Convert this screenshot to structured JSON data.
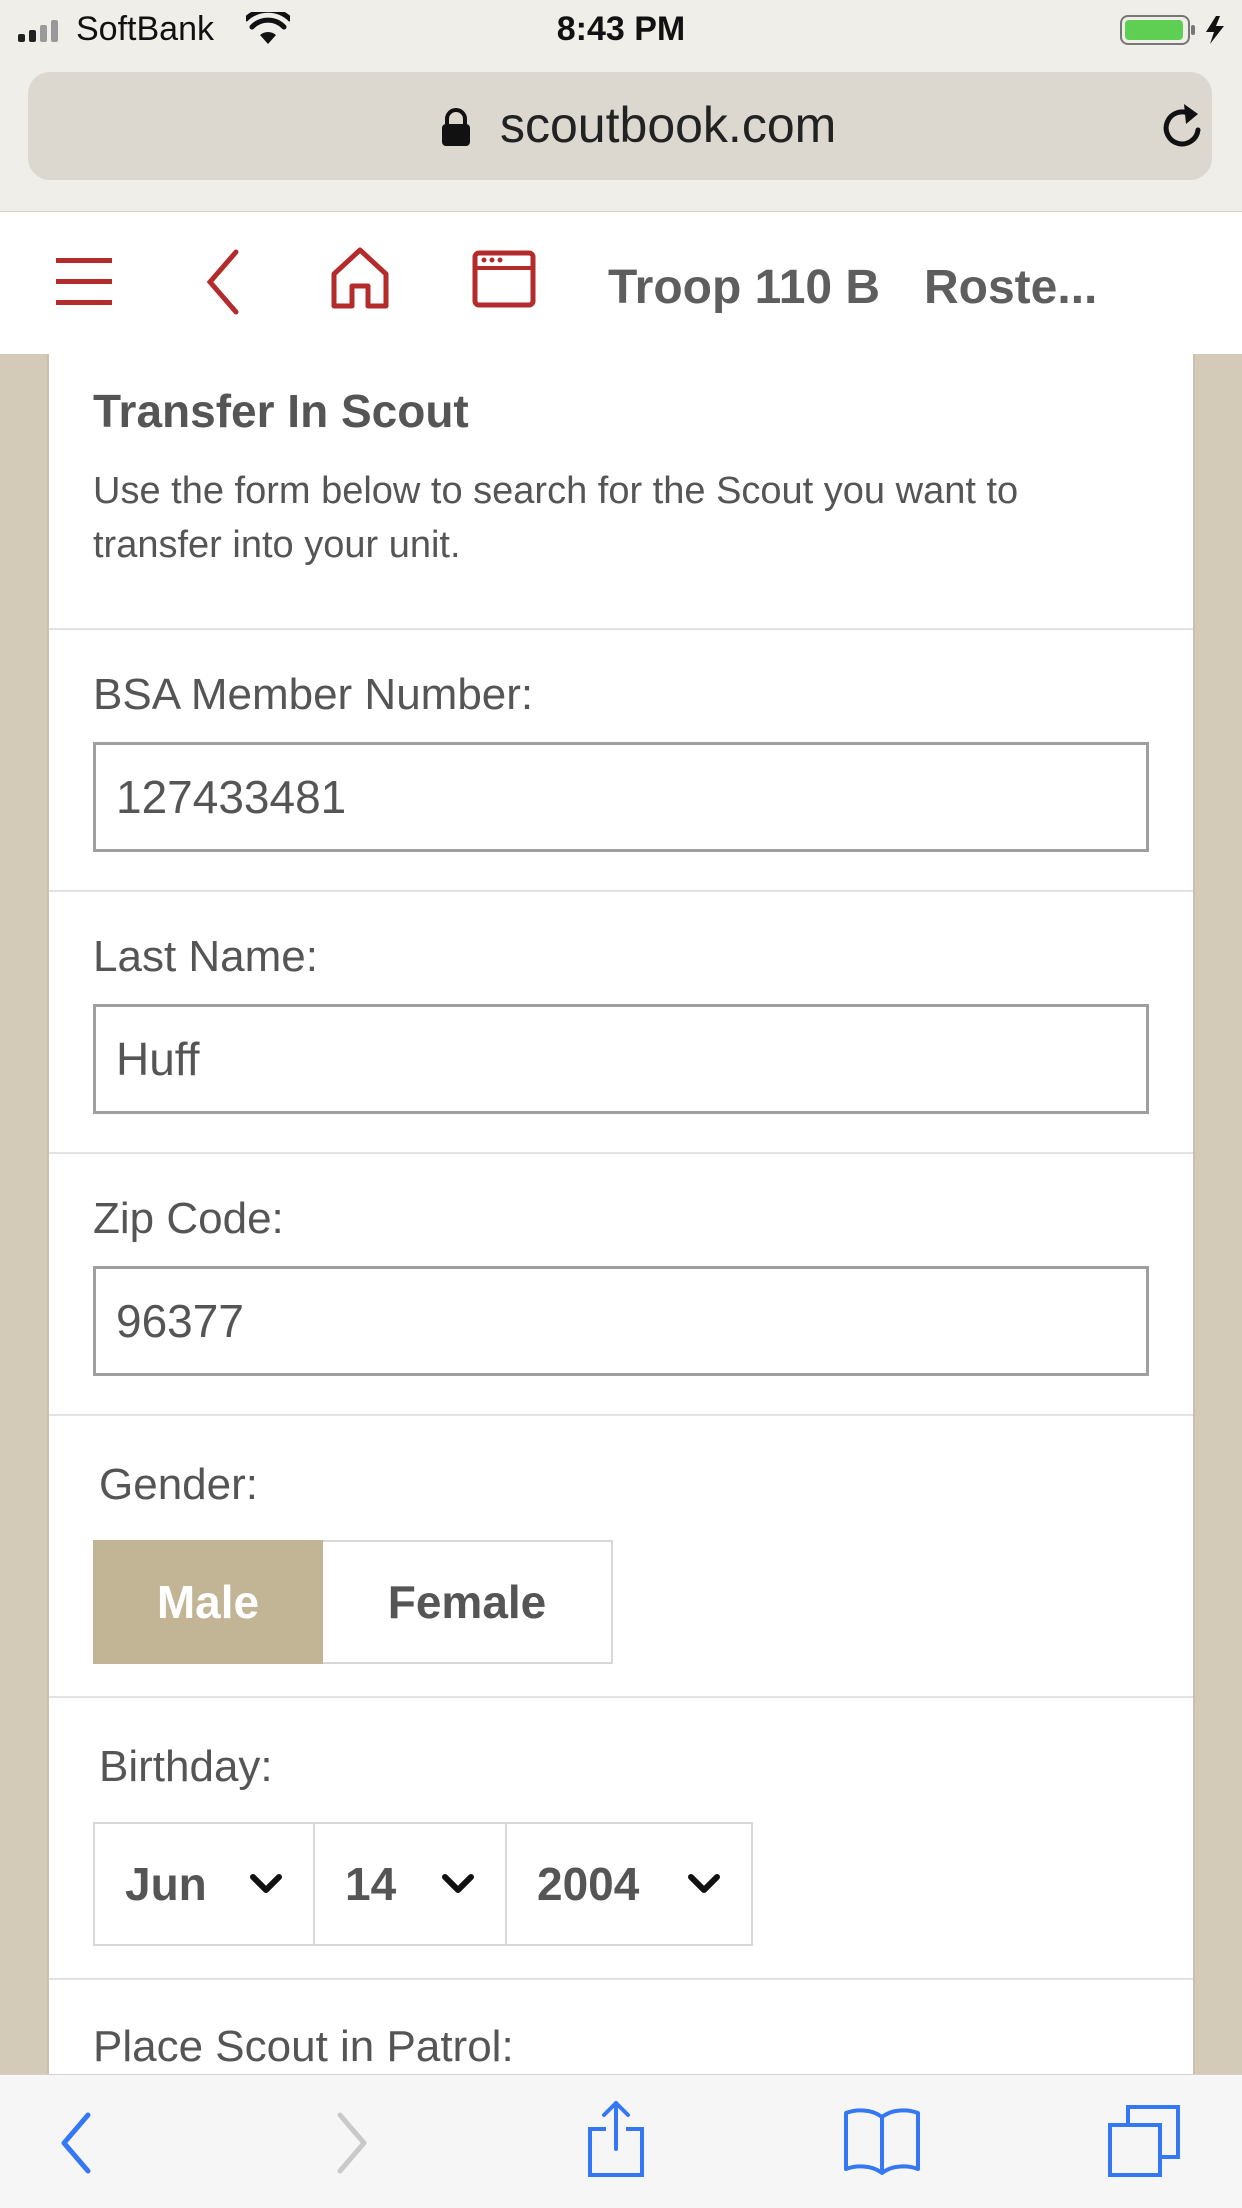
{
  "status": {
    "carrier": "SoftBank",
    "time": "8:43 PM"
  },
  "browser": {
    "url": "scoutbook.com"
  },
  "header": {
    "title": "Troop 110 B",
    "subtitle": "Roste..."
  },
  "form": {
    "title": "Transfer In Scout",
    "description": "Use the form below to search for the Scout you want to transfer into your unit.",
    "member_number": {
      "label": "BSA Member Number:",
      "value": "127433481"
    },
    "last_name": {
      "label": "Last Name:",
      "value": "Huff"
    },
    "zip": {
      "label": "Zip Code:",
      "value": "96377"
    },
    "gender": {
      "label": "Gender:",
      "options": [
        "Male",
        "Female"
      ],
      "selected": "Male"
    },
    "birthday": {
      "label": "Birthday:",
      "month": "Jun",
      "day": "14",
      "year": "2004"
    },
    "patrol": {
      "label": "Place Scout in Patrol:"
    }
  },
  "colors": {
    "accent_red": "#b32b2b",
    "gender_active": "#c2b595",
    "page_bg": "#d3cbb8",
    "ios_blue": "#3478f6"
  },
  "icons": [
    "menu-icon",
    "back-icon",
    "home-icon",
    "calendar-icon",
    "lock-icon",
    "reload-icon",
    "chevron-down-icon",
    "share-icon",
    "bookmarks-icon",
    "tabs-icon"
  ]
}
